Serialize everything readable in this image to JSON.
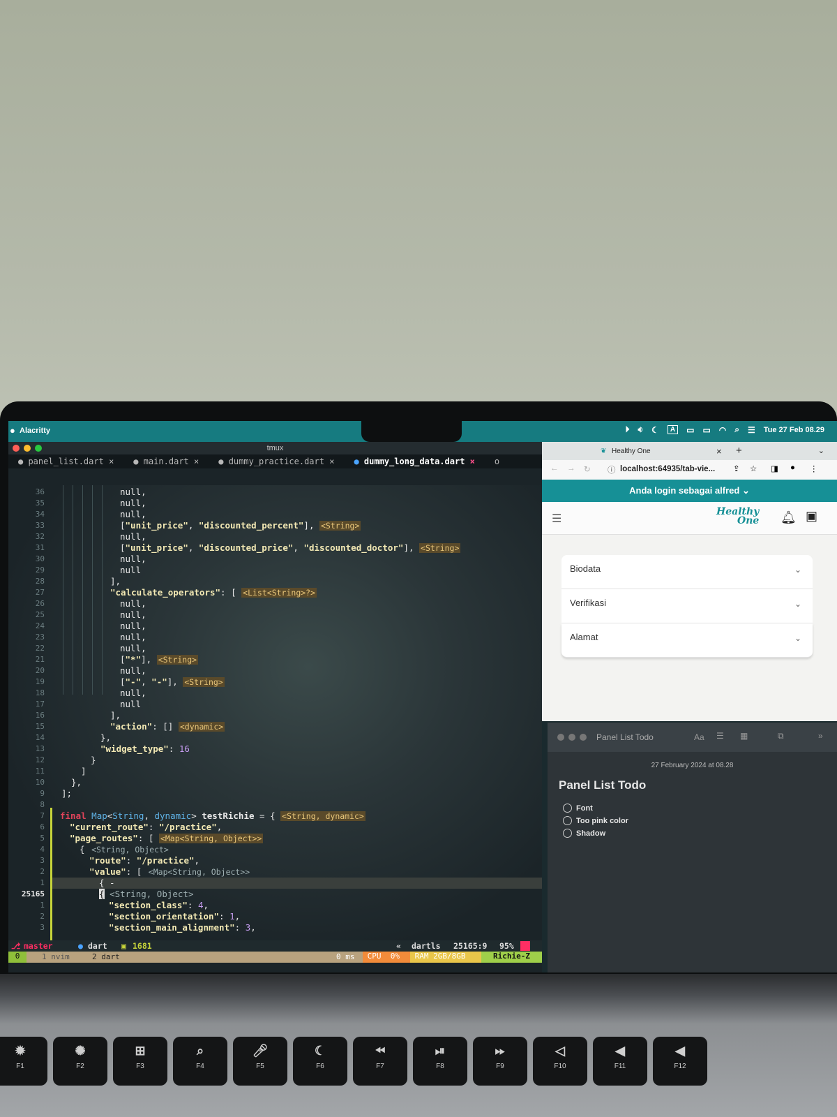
{
  "menubar": {
    "app_name": "Alacritty",
    "datetime": "Tue 27 Feb 08.29",
    "icons": [
      "apple-icon",
      "play-icon",
      "volume-icon",
      "moon-icon",
      "input-source-icon",
      "display-icon",
      "battery-icon",
      "wifi-icon",
      "search-icon",
      "control-center-icon"
    ]
  },
  "terminal": {
    "window_title": "tmux",
    "tabs": [
      {
        "label": "panel_list.dart",
        "close": "×"
      },
      {
        "label": "main.dart",
        "close": "×"
      },
      {
        "label": "dummy_practice.dart",
        "close": "×"
      },
      {
        "label": "dummy_long_data.dart",
        "close": "×"
      }
    ],
    "tab_status": "o",
    "line_numbers": [
      "36",
      "35",
      "34",
      "33",
      "32",
      "31",
      "30",
      "29",
      "28",
      "27",
      "26",
      "25",
      "24",
      "23",
      "22",
      "21",
      "20",
      "19",
      "18",
      "17",
      "16",
      "15",
      "14",
      "13",
      "12",
      "11",
      "10",
      "9",
      "8",
      "7",
      "6",
      "5",
      "4",
      "3",
      "2",
      "1",
      "25165",
      "1",
      "2",
      "3"
    ],
    "statusline": {
      "branch": "master",
      "filetype": "dart",
      "count": "1681",
      "lsp": "dartls",
      "position": "25165:9",
      "percent": "95%"
    },
    "tmux": {
      "session": "0",
      "window1": "1 nvim",
      "window2": "2 dart",
      "latency": "0 ms",
      "cpu_label": "CPU",
      "cpu": "0%",
      "ram_label": "RAM",
      "ram": "2GB/8GB",
      "user": "Richie-Z"
    }
  },
  "browser": {
    "tab_title": "Healthy One",
    "tab_close": "×",
    "new_tab": "+",
    "address": "localhost:64935/tab-vie...",
    "banner": "Anda login sebagai alfred",
    "logo_line1": "Healthy",
    "logo_line2": "One",
    "accordion": [
      "Biodata",
      "Verifikasi",
      "Alamat"
    ]
  },
  "notes": {
    "window_title": "Panel List Todo",
    "format_label": "Aa",
    "date": "27 February 2024 at 08.28",
    "heading": "Panel List Todo",
    "items": [
      "Font",
      "Too pink color",
      "Shadow"
    ]
  },
  "keyboard": [
    {
      "icon": "brightness-down-icon",
      "glyph": "✹",
      "label": "F1"
    },
    {
      "icon": "brightness-up-icon",
      "glyph": "✺",
      "label": "F2"
    },
    {
      "icon": "mission-control-icon",
      "glyph": "⊞",
      "label": "F3"
    },
    {
      "icon": "spotlight-icon",
      "glyph": "⌕",
      "label": "F4"
    },
    {
      "icon": "dictation-icon",
      "glyph": "🎤︎",
      "label": "F5"
    },
    {
      "icon": "dnd-icon",
      "glyph": "☾",
      "label": "F6"
    },
    {
      "icon": "rewind-icon",
      "glyph": "⏪︎",
      "label": "F7"
    },
    {
      "icon": "play-pause-icon",
      "glyph": "⏯︎",
      "label": "F8"
    },
    {
      "icon": "fast-forward-icon",
      "glyph": "⏩︎",
      "label": "F9"
    },
    {
      "icon": "mute-icon",
      "glyph": "◁",
      "label": "F10"
    },
    {
      "icon": "volume-down-icon",
      "glyph": "◀",
      "label": "F11"
    },
    {
      "icon": "volume-up-icon",
      "glyph": "◀",
      "label": "F12"
    }
  ],
  "colors": {
    "menubar": "#167b80",
    "banner": "#169096",
    "branch_red": "#ff2e63",
    "string": "#f3e9b4",
    "keyword": "#e0435a"
  }
}
